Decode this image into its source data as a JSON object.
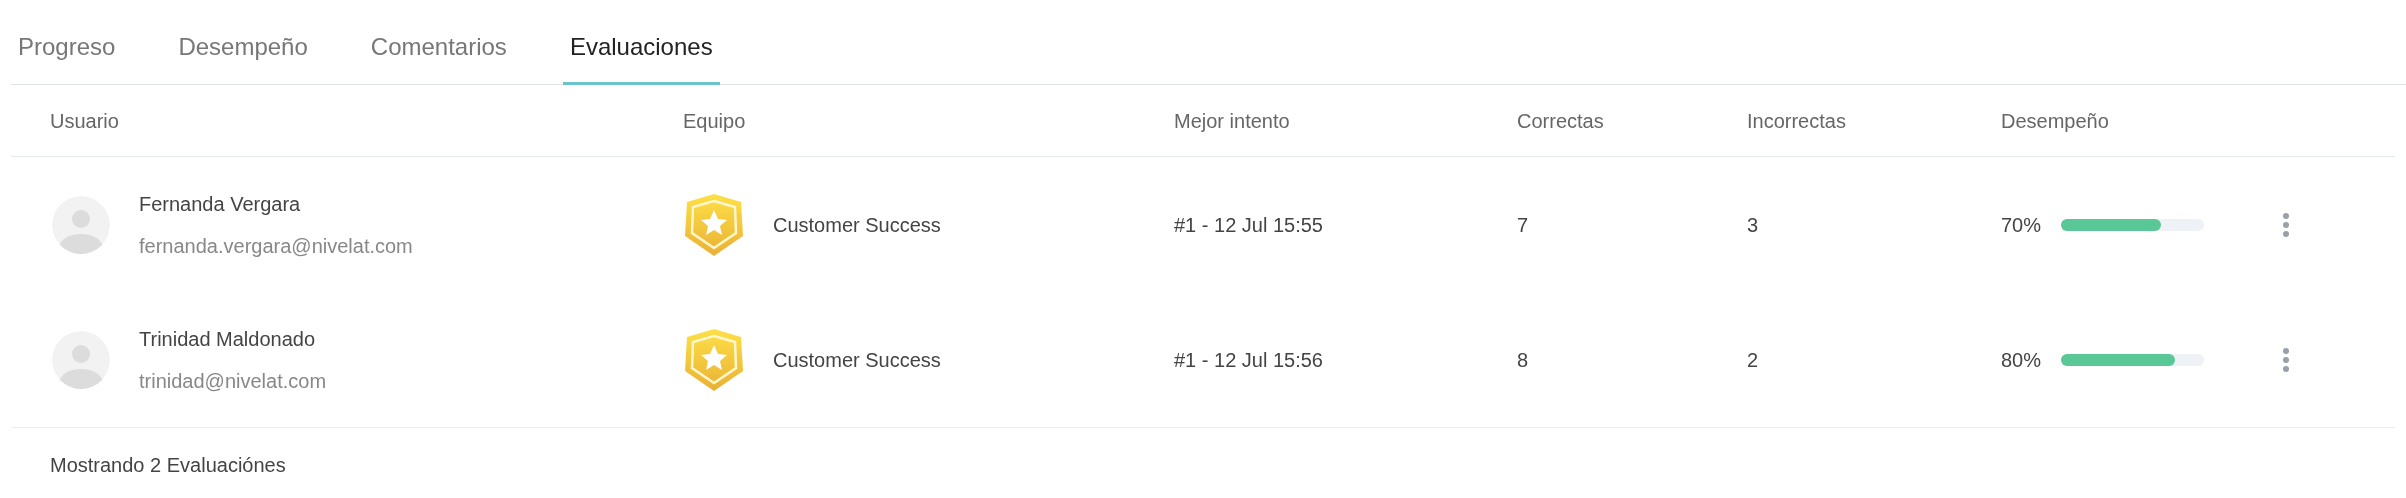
{
  "tabs": [
    {
      "label": "Progreso",
      "selected": false
    },
    {
      "label": "Desempeño",
      "selected": false
    },
    {
      "label": "Comentarios",
      "selected": false
    },
    {
      "label": "Evaluaciones",
      "selected": true
    }
  ],
  "table": {
    "columns": [
      "Usuario",
      "Equipo",
      "Mejor intento",
      "Correctas",
      "Incorrectas",
      "Desempeño"
    ],
    "rows": [
      {
        "name": "Fernanda Vergara",
        "email": "fernanda.vergara@nivelat.com",
        "team": "Customer Success",
        "best_attempt": "#1 - 12 Jul 15:55",
        "correct": "7",
        "incorrect": "3",
        "performance": "70%",
        "level": 0.7
      },
      {
        "name": "Trinidad Maldonado",
        "email": "trinidad@nivelat.com",
        "team": "Customer Success",
        "best_attempt": "#1 - 12 Jul 15:56",
        "correct": "8",
        "incorrect": "2",
        "performance": "80%",
        "level": 0.8
      }
    ]
  },
  "footer": "Mostrando 2 Evaluaciónes"
}
